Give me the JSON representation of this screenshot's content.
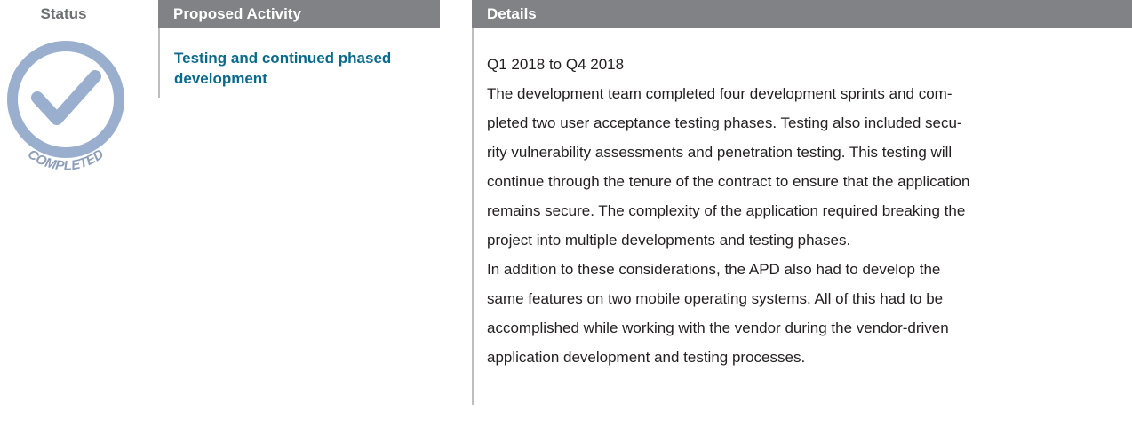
{
  "headers": {
    "status": "Status",
    "activity": "Proposed Activity",
    "details": "Details"
  },
  "badge": {
    "label": "COMPLETED",
    "icon": "checkmark-icon",
    "colors": {
      "ring": "#9aafcd",
      "check": "#9aafcd",
      "text": "#8d9eb8"
    }
  },
  "activity": {
    "title": "Testing and continued phased development"
  },
  "details": {
    "dates": "Q1 2018 to Q4 2018",
    "paragraph1_lines": [
      "The development team completed four development sprints and com-",
      "pleted two user acceptance testing phases. Testing also included secu-",
      "rity vulnerability assessments and penetration testing. This testing will",
      "continue through the tenure of the contract to ensure that the application",
      "remains secure. The complexity of the application required breaking the",
      "project into multiple developments and testing phases."
    ],
    "paragraph2_lines": [
      "In addition to these considerations, the APD also had to develop the",
      "same features on two mobile operating systems. All of this had to be",
      "accomplished while working with the vendor during the vendor-driven",
      "application development and testing processes."
    ]
  },
  "colors": {
    "header_bg": "#808285",
    "accent_text": "#0a6a8c",
    "status_text": "#6d6e71"
  }
}
